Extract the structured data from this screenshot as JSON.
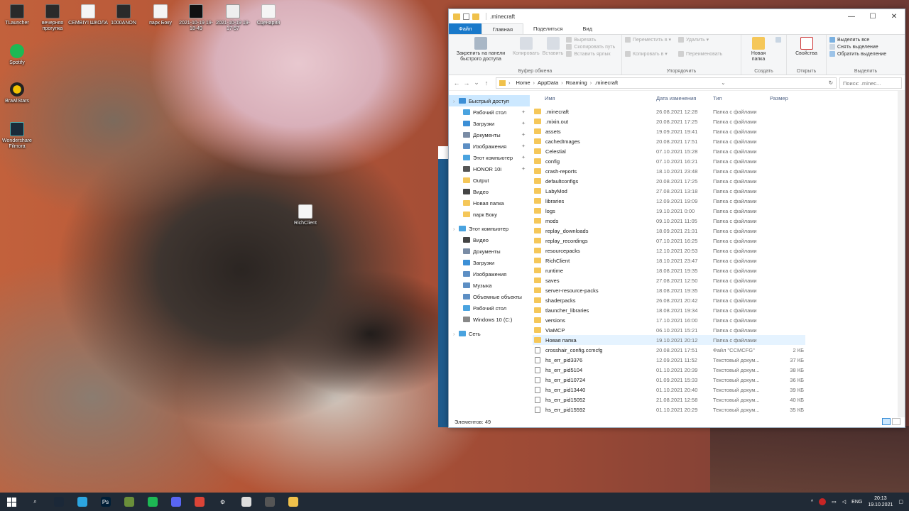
{
  "desktop": {
    "icons": [
      {
        "label": "TLauncher",
        "icon": "tlauncher-icon",
        "style": "ic-dark"
      },
      {
        "label": "вечерняя прогулка",
        "icon": "file-icon",
        "style": "ic-dark"
      },
      {
        "label": "CEMBIYI ШКОЛА",
        "icon": "file-icon",
        "style": "ic-doc"
      },
      {
        "label": "1000ANON",
        "icon": "file-icon",
        "style": "ic-dark"
      },
      {
        "label": "парк Боку",
        "icon": "file-icon",
        "style": "ic-doc"
      },
      {
        "label": "2021-10-19 19-18-49",
        "icon": "video-file-icon",
        "style": "ic-shot"
      },
      {
        "label": "2021-10-19 19-17-57",
        "icon": "video-file-icon",
        "style": "ic-shot2"
      },
      {
        "label": "Сценарий",
        "icon": "document-icon",
        "style": "ic-doc"
      },
      {
        "label": "Spotify",
        "icon": "spotify-icon",
        "style": "ic-green"
      },
      {
        "label": "BrawlStars",
        "icon": "brawlstars-icon",
        "style": "ic-brawl"
      },
      {
        "label": "Wondershare Filmora",
        "icon": "filmora-icon",
        "style": "ic-film"
      },
      {
        "label": "RichClient",
        "icon": "file-icon",
        "style": "ic-doc"
      }
    ]
  },
  "explorer": {
    "title": ".minecraft",
    "controls": {
      "minimize": "—",
      "maximize": "☐",
      "close": "✕"
    },
    "tabs": [
      "Файл",
      "Главная",
      "Поделиться",
      "Вид"
    ],
    "ribbon": {
      "clipboard": {
        "pin": "Закрепить на панели быстрого доступа",
        "copy": "Копировать",
        "paste": "Вставить",
        "cut": "Вырезать",
        "copy_path": "Скопировать путь",
        "paste_shortcut": "Вставить ярлык",
        "group": "Буфер обмена"
      },
      "organize": {
        "move_to": "Переместить в ▾",
        "copy_to": "Копировать в ▾",
        "delete": "Удалить ▾",
        "rename": "Переименовать",
        "group": "Упорядочить"
      },
      "create": {
        "new_folder": "Новая папка",
        "group": "Создать"
      },
      "open": {
        "properties": "Свойства",
        "group": "Открыть"
      },
      "select": {
        "select_all": "Выделить все",
        "select_none": "Снять выделение",
        "invert": "Обратить выделение",
        "group": "Выделить"
      }
    },
    "address": {
      "segments": [
        "Home",
        "AppData",
        "Roaming",
        ".minecraft"
      ],
      "search_placeholder": "Поиск: .minec...",
      "refresh": "↻",
      "dropdown": "⌄"
    },
    "nav": [
      {
        "label": "Быстрый доступ",
        "top": true,
        "sel": true,
        "color": "#3c8fd6",
        "icon": "star-icon"
      },
      {
        "label": "Рабочий стол",
        "pin": true,
        "color": "#4aa3df",
        "icon": "desktop-icon"
      },
      {
        "label": "Загрузки",
        "pin": true,
        "color": "#3c8fd6",
        "icon": "download-icon"
      },
      {
        "label": "Документы",
        "pin": true,
        "color": "#7a8ca5",
        "icon": "documents-icon"
      },
      {
        "label": "Изображения",
        "pin": true,
        "color": "#5d8fc4",
        "icon": "images-icon"
      },
      {
        "label": "Этот компьютер",
        "pin": true,
        "color": "#4aa3df",
        "icon": "computer-icon"
      },
      {
        "label": "HONOR 10i",
        "pin": true,
        "color": "#555555",
        "icon": "phone-icon"
      },
      {
        "label": "Output",
        "color": "#f5c759",
        "icon": "folder-icon"
      },
      {
        "label": "Видео",
        "color": "#444444",
        "icon": "video-icon"
      },
      {
        "label": "Новая папка",
        "color": "#f5c759",
        "icon": "folder-icon"
      },
      {
        "label": "парк Боку",
        "color": "#f5c759",
        "icon": "folder-icon"
      },
      {
        "gap": true
      },
      {
        "label": "Этот компьютер",
        "top": true,
        "color": "#4aa3df",
        "icon": "computer-icon"
      },
      {
        "label": "Видео",
        "color": "#444444",
        "icon": "video-icon"
      },
      {
        "label": "Документы",
        "color": "#7a8ca5",
        "icon": "documents-icon"
      },
      {
        "label": "Загрузки",
        "color": "#3c8fd6",
        "icon": "download-icon"
      },
      {
        "label": "Изображения",
        "color": "#5d8fc4",
        "icon": "images-icon"
      },
      {
        "label": "Музыка",
        "color": "#5d8fc4",
        "icon": "music-icon"
      },
      {
        "label": "Объемные объекты",
        "color": "#5d8fc4",
        "icon": "3d-objects-icon"
      },
      {
        "label": "Рабочий стол",
        "color": "#4aa3df",
        "icon": "desktop-icon"
      },
      {
        "label": "Windows 10 (C:)",
        "color": "#888888",
        "icon": "drive-icon"
      },
      {
        "gap": true
      },
      {
        "label": "Сеть",
        "top": true,
        "color": "#4aa3df",
        "icon": "network-icon"
      }
    ],
    "columns": {
      "name": "Имя",
      "date": "Дата изменения",
      "type": "Тип",
      "size": "Размер"
    },
    "files": [
      {
        "name": ".minecraft",
        "date": "26.08.2021 12:28",
        "type": "Папка с файлами",
        "size": "",
        "kind": "folder"
      },
      {
        "name": ".mixin.out",
        "date": "20.08.2021 17:25",
        "type": "Папка с файлами",
        "size": "",
        "kind": "folder"
      },
      {
        "name": "assets",
        "date": "19.09.2021 19:41",
        "type": "Папка с файлами",
        "size": "",
        "kind": "folder"
      },
      {
        "name": "cachedImages",
        "date": "20.08.2021 17:51",
        "type": "Папка с файлами",
        "size": "",
        "kind": "folder"
      },
      {
        "name": "Celestial",
        "date": "07.10.2021 15:28",
        "type": "Папка с файлами",
        "size": "",
        "kind": "folder"
      },
      {
        "name": "config",
        "date": "07.10.2021 16:21",
        "type": "Папка с файлами",
        "size": "",
        "kind": "folder"
      },
      {
        "name": "crash-reports",
        "date": "18.10.2021 23:48",
        "type": "Папка с файлами",
        "size": "",
        "kind": "folder"
      },
      {
        "name": "defaultconfigs",
        "date": "20.08.2021 17:25",
        "type": "Папка с файлами",
        "size": "",
        "kind": "folder"
      },
      {
        "name": "LabyMod",
        "date": "27.08.2021 13:18",
        "type": "Папка с файлами",
        "size": "",
        "kind": "folder"
      },
      {
        "name": "libraries",
        "date": "12.09.2021 19:09",
        "type": "Папка с файлами",
        "size": "",
        "kind": "folder"
      },
      {
        "name": "logs",
        "date": "19.10.2021 0:00",
        "type": "Папка с файлами",
        "size": "",
        "kind": "folder"
      },
      {
        "name": "mods",
        "date": "09.10.2021 11:05",
        "type": "Папка с файлами",
        "size": "",
        "kind": "folder"
      },
      {
        "name": "replay_downloads",
        "date": "18.09.2021 21:31",
        "type": "Папка с файлами",
        "size": "",
        "kind": "folder"
      },
      {
        "name": "replay_recordings",
        "date": "07.10.2021 16:25",
        "type": "Папка с файлами",
        "size": "",
        "kind": "folder"
      },
      {
        "name": "resourcepacks",
        "date": "12.10.2021 20:53",
        "type": "Папка с файлами",
        "size": "",
        "kind": "folder"
      },
      {
        "name": "RichClient",
        "date": "18.10.2021 23:47",
        "type": "Папка с файлами",
        "size": "",
        "kind": "folder"
      },
      {
        "name": "runtime",
        "date": "18.08.2021 19:35",
        "type": "Папка с файлами",
        "size": "",
        "kind": "folder"
      },
      {
        "name": "saves",
        "date": "27.08.2021 12:50",
        "type": "Папка с файлами",
        "size": "",
        "kind": "folder"
      },
      {
        "name": "server-resource-packs",
        "date": "18.08.2021 19:35",
        "type": "Папка с файлами",
        "size": "",
        "kind": "folder"
      },
      {
        "name": "shaderpacks",
        "date": "26.08.2021 20:42",
        "type": "Папка с файлами",
        "size": "",
        "kind": "folder"
      },
      {
        "name": "tlauncher_libraries",
        "date": "18.08.2021 19:34",
        "type": "Папка с файлами",
        "size": "",
        "kind": "folder"
      },
      {
        "name": "versions",
        "date": "17.10.2021 16:00",
        "type": "Папка с файлами",
        "size": "",
        "kind": "folder"
      },
      {
        "name": "ViaMCP",
        "date": "06.10.2021 15:21",
        "type": "Папка с файлами",
        "size": "",
        "kind": "folder"
      },
      {
        "name": "Новая папка",
        "date": "19.10.2021 20:12",
        "type": "Папка с файлами",
        "size": "",
        "kind": "folder",
        "hover": true
      },
      {
        "name": "crosshair_config.ccmcfg",
        "date": "20.08.2021 17:51",
        "type": "Файл \"CCMCFG\"",
        "size": "2 КБ",
        "kind": "file"
      },
      {
        "name": "hs_err_pid3376",
        "date": "12.09.2021 11:52",
        "type": "Текстовый докум...",
        "size": "37 КБ",
        "kind": "file"
      },
      {
        "name": "hs_err_pid5104",
        "date": "01.10.2021 20:39",
        "type": "Текстовый докум...",
        "size": "38 КБ",
        "kind": "file"
      },
      {
        "name": "hs_err_pid10724",
        "date": "01.09.2021 15:33",
        "type": "Текстовый докум...",
        "size": "36 КБ",
        "kind": "file"
      },
      {
        "name": "hs_err_pid13440",
        "date": "01.10.2021 20:40",
        "type": "Текстовый докум...",
        "size": "39 КБ",
        "kind": "file"
      },
      {
        "name": "hs_err_pid15052",
        "date": "21.08.2021 12:58",
        "type": "Текстовый докум...",
        "size": "40 КБ",
        "kind": "file"
      },
      {
        "name": "hs_err_pid15592",
        "date": "01.10.2021 20:29",
        "type": "Текстовый докум...",
        "size": "35 КБ",
        "kind": "file"
      }
    ],
    "status": "Элементов: 49"
  },
  "taskbar": {
    "apps": [
      {
        "name": "search-icon",
        "color": "#202a36",
        "glyph": "⌕"
      },
      {
        "name": "steam-icon",
        "color": "#1b2838",
        "glyph": ""
      },
      {
        "name": "telegram-icon",
        "color": "#2ca5e0",
        "glyph": ""
      },
      {
        "name": "photoshop-icon",
        "color": "#001e36",
        "glyph": "Ps"
      },
      {
        "name": "minecraft-launcher-icon",
        "color": "#6a8f3a",
        "glyph": ""
      },
      {
        "name": "spotify-icon",
        "color": "#1db954",
        "glyph": ""
      },
      {
        "name": "discord-icon",
        "color": "#5865f2",
        "glyph": ""
      },
      {
        "name": "chrome-icon",
        "color": "#db4437",
        "glyph": ""
      },
      {
        "name": "settings-icon",
        "color": "#202a36",
        "glyph": "⚙"
      },
      {
        "name": "tlauncher-icon",
        "color": "#dddddd",
        "glyph": ""
      },
      {
        "name": "minecraft-icon",
        "color": "#555555",
        "glyph": ""
      },
      {
        "name": "file-explorer-icon",
        "color": "#f0c14b",
        "glyph": ""
      }
    ],
    "tray": {
      "lang": "ENG",
      "time": "20:13",
      "date": "19.10.2021",
      "chevron": "^"
    }
  }
}
